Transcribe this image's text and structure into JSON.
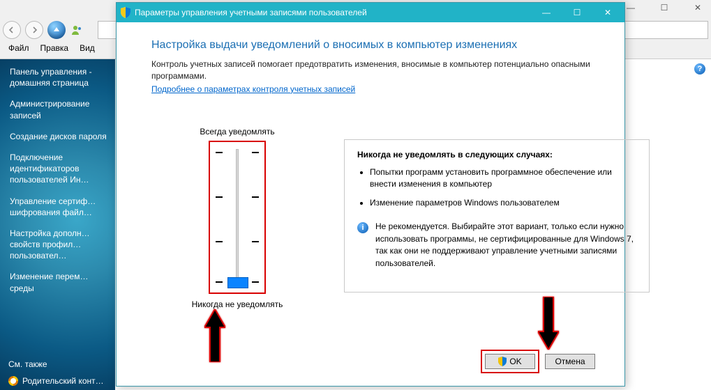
{
  "bg": {
    "menu": {
      "file": "Файл",
      "edit": "Правка",
      "view": "Вид"
    },
    "side": {
      "home": "Панель управления - домашняя страница",
      "admin": "Администрирование записей",
      "create": "Создание дисков пароля",
      "connect": "Подключение идентификаторов пользователей Ин…",
      "manage_cert": "Управление сертиф… шифрования файл…",
      "configure": "Настройка дополн… свойств профил… пользовател…",
      "change_env": "Изменение перем… среды",
      "see_also": "См. также",
      "parental": "Родительский конт…"
    },
    "win": {
      "min": "—",
      "max": "☐",
      "close": "✕"
    }
  },
  "dlg": {
    "title": "Параметры управления учетными записями пользователей",
    "win": {
      "min": "—",
      "max": "☐",
      "close": "✕"
    },
    "heading": "Настройка выдачи уведомлений о вносимых в компьютер изменениях",
    "intro": "Контроль учетных записей помогает предотвратить изменения, вносимые в компьютер потенциально опасными программами.",
    "learn_more": "Подробнее о параметрах контроля учетных записей",
    "slider": {
      "top_label": "Всегда уведомлять",
      "bottom_label": "Никогда не уведомлять",
      "value_index": 3,
      "levels": 4
    },
    "desc": {
      "title": "Никогда не уведомлять в следующих случаях:",
      "item1": "Попытки программ установить программное обеспечение или внести изменения в компьютер",
      "item2": "Изменение параметров Windows пользователем",
      "warn": "Не рекомендуется. Выбирайте этот вариант, только если нужно использовать программы, не сертифицированные для Windows 7, так как они не поддерживают управление учетными записями пользователей."
    },
    "buttons": {
      "ok": "OK",
      "cancel": "Отмена"
    }
  }
}
